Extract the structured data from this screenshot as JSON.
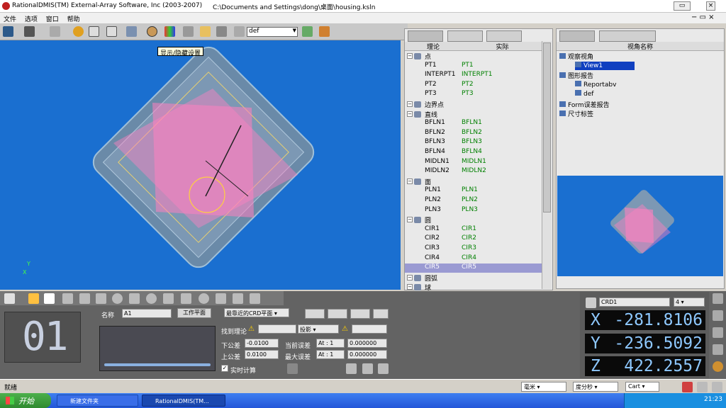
{
  "window": {
    "app_title": "RationalDMIS(TM) External-Array Software, Inc (2003-2007)",
    "file_path": "C:\\Documents and Settings\\dong\\桌面\\housing.ksln"
  },
  "menu": [
    "文件",
    "选项",
    "窗口",
    "帮助"
  ],
  "toolbar": {
    "combo_value": "def",
    "tooltip": "显示/隐藏设置"
  },
  "tree": {
    "col_nominal": "理论",
    "col_actual": "实际",
    "groups": [
      {
        "label": "点",
        "items": [
          [
            "PT1",
            "PT1"
          ],
          [
            "INTERPT1",
            "INTERPT1"
          ],
          [
            "PT2",
            "PT2"
          ],
          [
            "PT3",
            "PT3"
          ]
        ]
      },
      {
        "label": "边界点",
        "items": []
      },
      {
        "label": "直线",
        "items": [
          [
            "BFLN1",
            "BFLN1"
          ],
          [
            "BFLN2",
            "BFLN2"
          ],
          [
            "BFLN3",
            "BFLN3"
          ],
          [
            "BFLN4",
            "BFLN4"
          ],
          [
            "MIDLN1",
            "MIDLN1"
          ],
          [
            "MIDLN2",
            "MIDLN2"
          ]
        ]
      },
      {
        "label": "面",
        "items": [
          [
            "PLN1",
            "PLN1"
          ],
          [
            "PLN2",
            "PLN2"
          ],
          [
            "PLN3",
            "PLN3"
          ]
        ]
      },
      {
        "label": "圆",
        "items": [
          [
            "CIR1",
            "CIR1"
          ],
          [
            "CIR2",
            "CIR2"
          ],
          [
            "CIR3",
            "CIR3"
          ],
          [
            "CIR4",
            "CIR4"
          ],
          [
            "CIR5",
            "CIR5"
          ]
        ]
      },
      {
        "label": "圆弧",
        "items": []
      },
      {
        "label": "球",
        "items": []
      }
    ],
    "selected_item": "CIR5"
  },
  "views": {
    "header": "视角名称",
    "items": [
      {
        "label": "观察视角",
        "level": 0
      },
      {
        "label": "View1",
        "level": 1,
        "selected": true
      },
      {
        "label": "图形报告",
        "level": 0
      },
      {
        "label": "Reportabv",
        "level": 1
      },
      {
        "label": "def",
        "level": 1
      },
      {
        "label": "Form误差报告",
        "level": 0
      },
      {
        "label": "尺寸标签",
        "level": 0
      }
    ]
  },
  "bottom": {
    "digits": "01",
    "name_label": "名称",
    "name_value": "A1",
    "workplane_btn": "工作平面",
    "crd_plane": "最靠近的CRD平面",
    "find_nominal_label": "找到理论",
    "projection": "投影",
    "lower_tol_label": "下公差",
    "lower_tol": "-0.0100",
    "upper_tol_label": "上公差",
    "upper_tol": "0.0100",
    "current_err_label": "当前误差",
    "current_err_at": "At : 1",
    "current_err": "0.000000",
    "max_err_label": "最大误差",
    "max_err_at": "At : 1",
    "max_err": "0.000000",
    "realtime_label": "实时计算"
  },
  "coords": {
    "crd": "CRD1",
    "crd_num": "4",
    "x_label": "X",
    "x": "-281.8106",
    "y_label": "Y",
    "y": "-236.5092",
    "z_label": "Z",
    "z": "422.2557"
  },
  "status": {
    "text": "就绪",
    "unit": "毫米",
    "angle": "度分秒",
    "coord_sys": "Cart"
  },
  "taskbar": {
    "start": "开始",
    "tasks": [
      "新建文件夹",
      "RationalDMIS(TM..."
    ],
    "clock": "21:23"
  },
  "colors": {
    "viewport": "#1a6fd0",
    "highlight": "#ff80c0",
    "coord_text": "#8ec8ff",
    "actual_text": "#008000"
  }
}
